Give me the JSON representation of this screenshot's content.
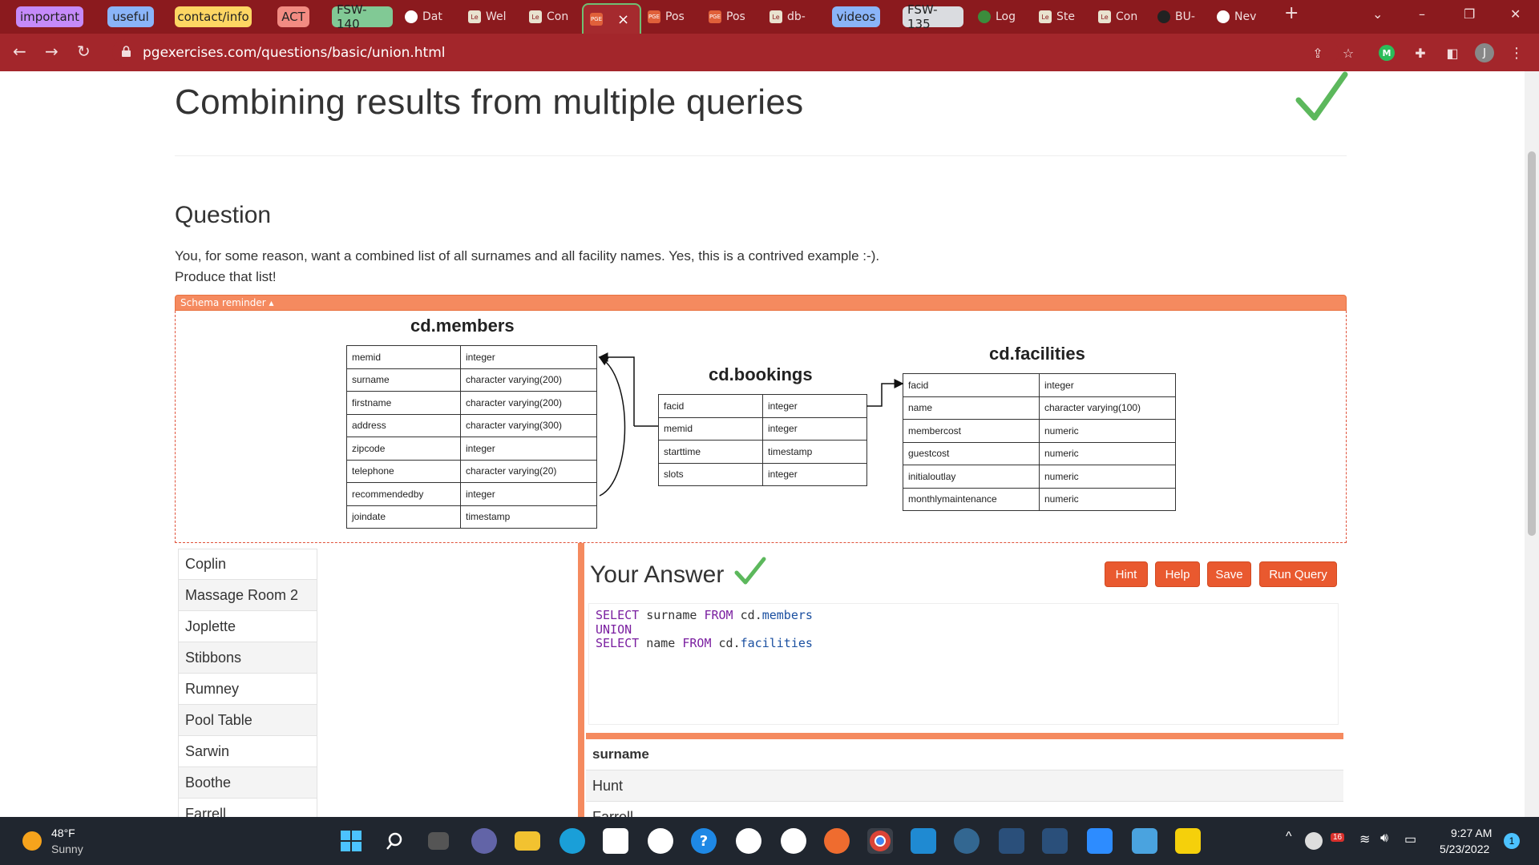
{
  "browser": {
    "tab_groups": [
      "important",
      "useful",
      "contact/info",
      "ACT",
      "FSW-140",
      "videos",
      "FSW-135"
    ],
    "tabs": [
      "Dat",
      "Wel",
      "Con",
      "Pos",
      "Pos",
      "db-",
      "Log",
      "Ste",
      "Con",
      "BU-",
      "Nev"
    ],
    "url": "pgexercises.com/questions/basic/union.html",
    "profile_initial": "J",
    "extension_label": "M",
    "new_tab_symbol": "+",
    "close_symbol": "×",
    "window_symbols": {
      "dropdown": "⌄",
      "minimize": "–",
      "restore": "❐",
      "close": "✕"
    },
    "nav_symbols": {
      "back": "←",
      "forward": "→",
      "reload": "↻",
      "share": "⇪",
      "bookmark": "☆",
      "extensions": "✚",
      "sidepanel": "◧",
      "menu": "⋮"
    }
  },
  "page": {
    "title": "Combining results from multiple queries",
    "question_heading": "Question",
    "question_line1": "You, for some reason, want a combined list of all surnames and all facility names. Yes, this is a contrived example :-).",
    "question_line2": "Produce that list!",
    "schema_toggle": "Schema reminder ▴"
  },
  "schema": {
    "members": {
      "title": "cd.members",
      "rows": [
        [
          "memid",
          "integer"
        ],
        [
          "surname",
          "character varying(200)"
        ],
        [
          "firstname",
          "character varying(200)"
        ],
        [
          "address",
          "character varying(300)"
        ],
        [
          "zipcode",
          "integer"
        ],
        [
          "telephone",
          "character varying(20)"
        ],
        [
          "recommendedby",
          "integer"
        ],
        [
          "joindate",
          "timestamp"
        ]
      ]
    },
    "bookings": {
      "title": "cd.bookings",
      "rows": [
        [
          "facid",
          "integer"
        ],
        [
          "memid",
          "integer"
        ],
        [
          "starttime",
          "timestamp"
        ],
        [
          "slots",
          "integer"
        ]
      ]
    },
    "facilities": {
      "title": "cd.facilities",
      "rows": [
        [
          "facid",
          "integer"
        ],
        [
          "name",
          "character varying(100)"
        ],
        [
          "membercost",
          "numeric"
        ],
        [
          "guestcost",
          "numeric"
        ],
        [
          "initialoutlay",
          "numeric"
        ],
        [
          "monthlymaintenance",
          "numeric"
        ]
      ]
    }
  },
  "expected_results": [
    "Coplin",
    "Massage Room 2",
    "Joplette",
    "Stibbons",
    "Rumney",
    "Pool Table",
    "Sarwin",
    "Boothe",
    "Farrell"
  ],
  "answer": {
    "heading": "Your Answer",
    "buttons": {
      "hint": "Hint",
      "help": "Help",
      "save": "Save",
      "run": "Run Query"
    },
    "query": {
      "kw_select": "SELECT",
      "col1": "surname",
      "kw_from": "FROM",
      "schema": "cd",
      "tbl1": "members",
      "kw_union": "UNION",
      "col2": "name",
      "tbl2": "facilities"
    },
    "results_header": "surname",
    "results": [
      "Hunt",
      "Farrell"
    ]
  },
  "taskbar": {
    "weather_temp": "48°F",
    "weather_desc": "Sunny",
    "time": "9:27 AM",
    "date": "5/23/2022",
    "notification_count": "1",
    "badge_count": "16"
  }
}
